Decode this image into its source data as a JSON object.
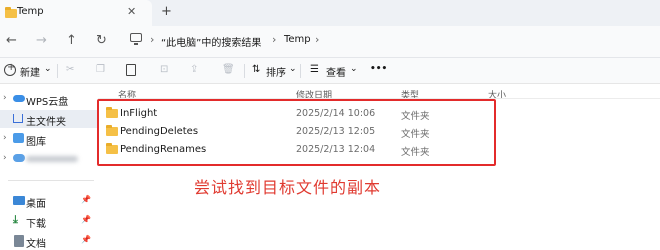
{
  "window": {
    "tab_title": "Temp",
    "tab_close": "✕",
    "new_tab": "+"
  },
  "nav": {
    "back": "←",
    "forward": "→",
    "up": "↑",
    "refresh": "↻",
    "breadcrumb": [
      "“此电脑”中的搜索结果",
      "Temp"
    ],
    "separator": "›"
  },
  "toolbar": {
    "new_label": "新建",
    "sort_label": "排序",
    "view_label": "查看",
    "more_label": "•••",
    "dropdown": "⌄"
  },
  "sidebar": {
    "items": [
      {
        "label": "WPS云盘",
        "icon": "cloud-icon",
        "expander": "›"
      },
      {
        "label": "主文件夹",
        "icon": "home-icon"
      },
      {
        "label": "图库",
        "icon": "gallery-icon",
        "expander": "›"
      },
      {
        "label": "",
        "icon": "user-cloud-icon",
        "expander": "›"
      },
      {
        "label": "桌面",
        "icon": "desktop-icon"
      },
      {
        "label": "下载",
        "icon": "download-icon"
      },
      {
        "label": "文档",
        "icon": "documents-icon"
      }
    ],
    "pin": "📌"
  },
  "columns": {
    "name": "名称",
    "modified": "修改日期",
    "type": "类型",
    "size": "大小"
  },
  "files": [
    {
      "name": "InFlight",
      "modified": "2025/2/14 10:06",
      "type": "文件夹"
    },
    {
      "name": "PendingDeletes",
      "modified": "2025/2/13 12:05",
      "type": "文件夹"
    },
    {
      "name": "PendingRenames",
      "modified": "2025/2/13 12:04",
      "type": "文件夹"
    }
  ],
  "annotation": {
    "text": "尝试找到目标文件的副本",
    "color": "#e03a30"
  },
  "colors": {
    "folder": "#f5c046",
    "highlight_border": "#e32b2b",
    "sidebar_active": "#e9edf3"
  }
}
